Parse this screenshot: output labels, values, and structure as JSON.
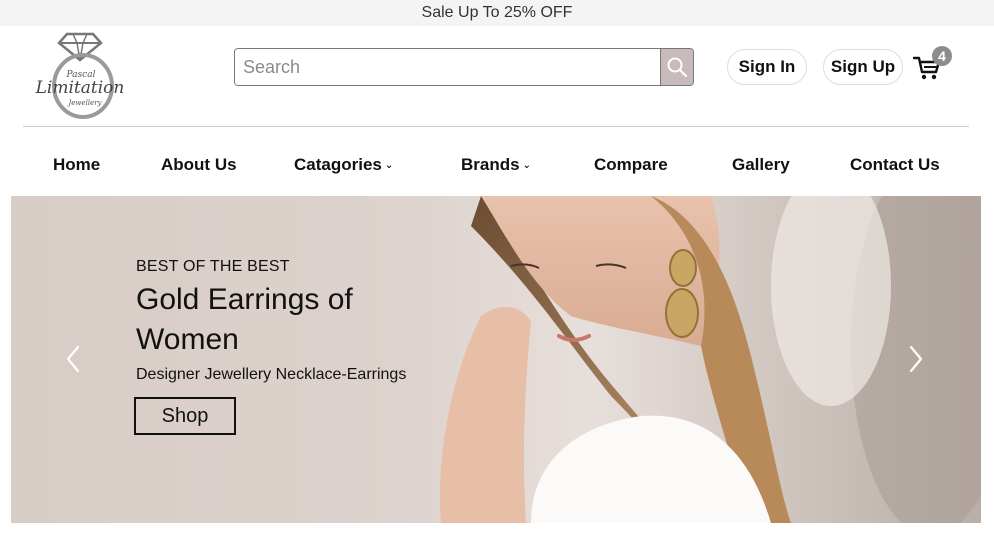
{
  "promo": {
    "text": "Sale Up To 25% OFF"
  },
  "brand": {
    "line1": "Pascal",
    "line2": "Limitation",
    "line3": "Jewellery"
  },
  "search": {
    "placeholder": "Search",
    "value": ""
  },
  "auth": {
    "sign_in": "Sign In",
    "sign_up": "Sign Up"
  },
  "cart": {
    "count": "4"
  },
  "nav": {
    "home": "Home",
    "about": "About Us",
    "categories": "Catagories",
    "brands": "Brands",
    "compare": "Compare",
    "gallery": "Gallery",
    "contact": "Contact Us",
    "chevron": "⌄"
  },
  "hero": {
    "eyebrow": "BEST OF THE BEST",
    "title": "Gold Earrings of Women",
    "subtitle": "Designer Jewellery Necklace-Earrings",
    "cta": "Shop"
  },
  "icons": {
    "search": "search-icon",
    "cart": "cart-icon",
    "prev": "chevron-left-icon",
    "next": "chevron-right-icon",
    "logo": "diamond-ring-logo"
  },
  "colors": {
    "search_button": "#c9bbbb",
    "badge": "#8c8c8c",
    "topbar": "#f4f4f4"
  }
}
